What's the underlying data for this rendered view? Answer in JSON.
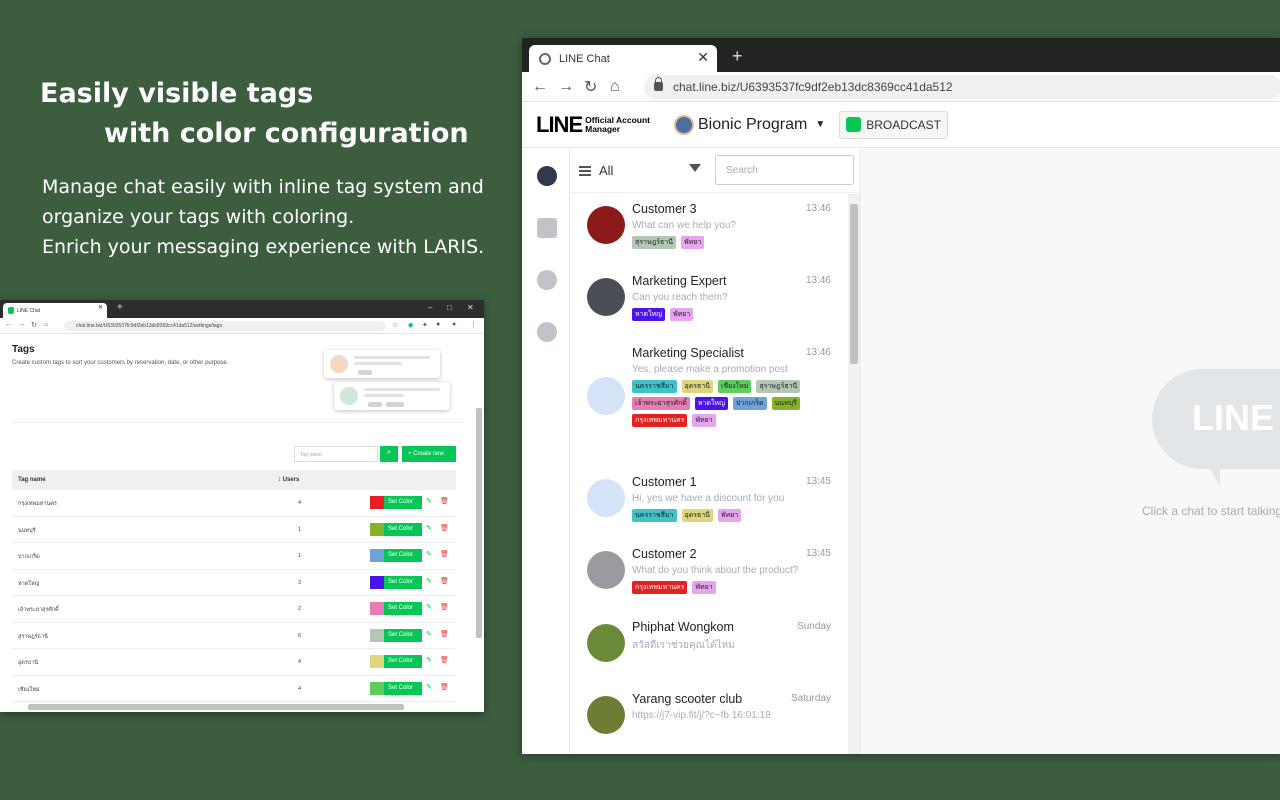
{
  "promo": {
    "headline_1": "Easily visible tags",
    "headline_2": "with color configuration",
    "desc_1": "Manage chat easily with inline tag system and",
    "desc_2": "organize your tags with coloring.",
    "desc_3": "Enrich your messaging experience with LARIS."
  },
  "main_browser": {
    "tab_title": "LINE Chat",
    "url": "chat.line.biz/U6393537fc9df2eb13dc8369cc41da512",
    "logo_big": "LINE",
    "logo_small_1": "Official Account",
    "logo_small_2": "Manager",
    "account_name": "Bionic Program",
    "broadcast_label": "BROADCAST",
    "filter_label": "All",
    "search_placeholder": "Search",
    "empty_logo": "LINE",
    "empty_text": "Click a chat to start talking",
    "chats": [
      {
        "name": "Customer 3",
        "time": "13:46",
        "message": "What can we help you?",
        "tags": [
          {
            "label": "สุราษฎร์ธานี",
            "color": "#b2c8b4"
          },
          {
            "label": "พัทยา",
            "color": "#e7a4ef"
          }
        ]
      },
      {
        "name": "Marketing Expert",
        "time": "13:46",
        "message": "Can you reach them?",
        "tags": [
          {
            "label": "หาดใหญ่",
            "color": "#4a14e8"
          },
          {
            "label": "พัทยา",
            "color": "#e7a4ef"
          }
        ]
      },
      {
        "name": "Marketing Specialist",
        "time": "13:46",
        "message": "Yes, please make a promotion post",
        "tags": [
          {
            "label": "นครราชสีมา",
            "color": "#3ec4c8"
          },
          {
            "label": "อุดรธานี",
            "color": "#dcd77e"
          },
          {
            "label": "เชียงใหม่",
            "color": "#5fcc5f"
          },
          {
            "label": "สุราษฎร์ธานี",
            "color": "#b2c8b4"
          },
          {
            "label": "เจ้าพระยาสุรศักดิ์",
            "color": "#e67eb6"
          },
          {
            "label": "หาดใหญ่",
            "color": "#4a14e8"
          },
          {
            "label": "ปากเกร็ด",
            "color": "#6fa3d8"
          },
          {
            "label": "นนทบุรี",
            "color": "#84b32a"
          },
          {
            "label": "กรุงเทพมหานคร",
            "color": "#e52020"
          },
          {
            "label": "พัทยา",
            "color": "#e7a4ef"
          }
        ]
      },
      {
        "name": "Customer 1",
        "time": "13:45",
        "message": "Hi, yes we have a discount for you",
        "tags": [
          {
            "label": "นครราชสีมา",
            "color": "#3ec4c8"
          },
          {
            "label": "อุดรธานี",
            "color": "#dcd77e"
          },
          {
            "label": "พัทยา",
            "color": "#e7a4ef"
          }
        ]
      },
      {
        "name": "Customer 2",
        "time": "13:45",
        "message": "What do you think about the product?",
        "tags": [
          {
            "label": "กรุงเทพมหานคร",
            "color": "#e52020"
          },
          {
            "label": "พัทยา",
            "color": "#e7a4ef"
          }
        ]
      },
      {
        "name": "Phiphat Wongkom",
        "time": "Sunday",
        "message": "สวัสดีเราช่วยคุณได้ไหม",
        "tags": []
      },
      {
        "name": "Yarang scooter club",
        "time": "Saturday",
        "message": "https://j7-vip.fit/j/?c~fb 16:01:18",
        "tags": []
      }
    ]
  },
  "small_browser": {
    "tab_title": "LINE Chat",
    "url": "chat.line.biz/U6393537fc9df2eb13dc8369cc41da512/settings/tags",
    "page_title": "Tags",
    "subtitle": "Create custom tags to sort your customers by reservation, date, or other purpose.",
    "search_placeholder": "Tag name",
    "create_label": "+ Create new",
    "col_name": "Tag name",
    "col_users": "↕ Users",
    "set_color_label": "Set Color",
    "rows": [
      {
        "name": "กรุงเทพมหานคร",
        "users": "4",
        "color": "#e52020"
      },
      {
        "name": "นนทบุรี",
        "users": "1",
        "color": "#84b32a"
      },
      {
        "name": "ปากเกร็ด",
        "users": "1",
        "color": "#6fa3d8"
      },
      {
        "name": "หาดใหญ่",
        "users": "3",
        "color": "#4a14e8"
      },
      {
        "name": "เจ้าพระยาสุรศักดิ์",
        "users": "2",
        "color": "#e67eb6"
      },
      {
        "name": "สุราษฎร์ธานี",
        "users": "6",
        "color": "#b2c8b4"
      },
      {
        "name": "อุดรธานี",
        "users": "4",
        "color": "#dcd77e"
      },
      {
        "name": "เชียงใหม่",
        "users": "4",
        "color": "#5fcc5f"
      }
    ]
  },
  "colors": {
    "background": "#3c5e3f",
    "line_green": "#06c755"
  }
}
